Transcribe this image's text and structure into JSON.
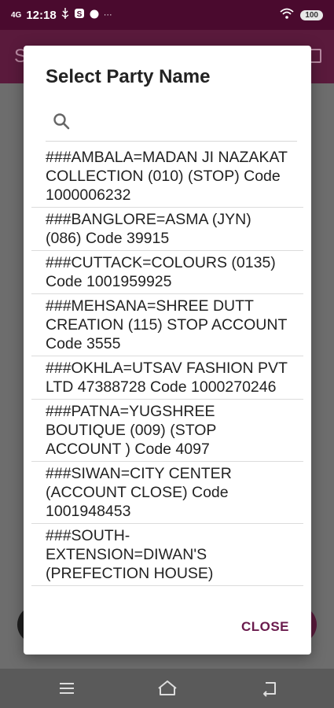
{
  "status_bar": {
    "signal": "4G",
    "time": "12:18",
    "icons": [
      "usb-icon",
      "s-icon",
      "dot-icon",
      "more-icon"
    ],
    "more": "···",
    "battery": "100"
  },
  "app_bar": {
    "letter": "S"
  },
  "dialog": {
    "title": "Select Party Name",
    "search_placeholder": "",
    "close_label": "CLOSE",
    "accent": "#6a1b4d"
  },
  "parties": [
    "###AMBALA=MADAN JI NAZAKAT COLLECTION (010) (STOP)  Code 1000006232",
    "###BANGLORE=ASMA (JYN) (086)  Code 39915",
    "###CUTTACK=COLOURS (0135)  Code 1001959925",
    "###MEHSANA=SHREE DUTT CREATION (115) STOP ACCOUNT  Code 3555",
    "###OKHLA=UTSAV FASHION PVT LTD 47388728  Code 1000270246",
    "###PATNA=YUGSHREE BOUTIQUE (009) (STOP ACCOUNT )  Code 4097",
    "###SIWAN=CITY CENTER (ACCOUNT CLOSE)  Code 1001948453",
    "###SOUTH-EXTENSION=DIWAN'S (PREFECTION HOUSE)"
  ]
}
